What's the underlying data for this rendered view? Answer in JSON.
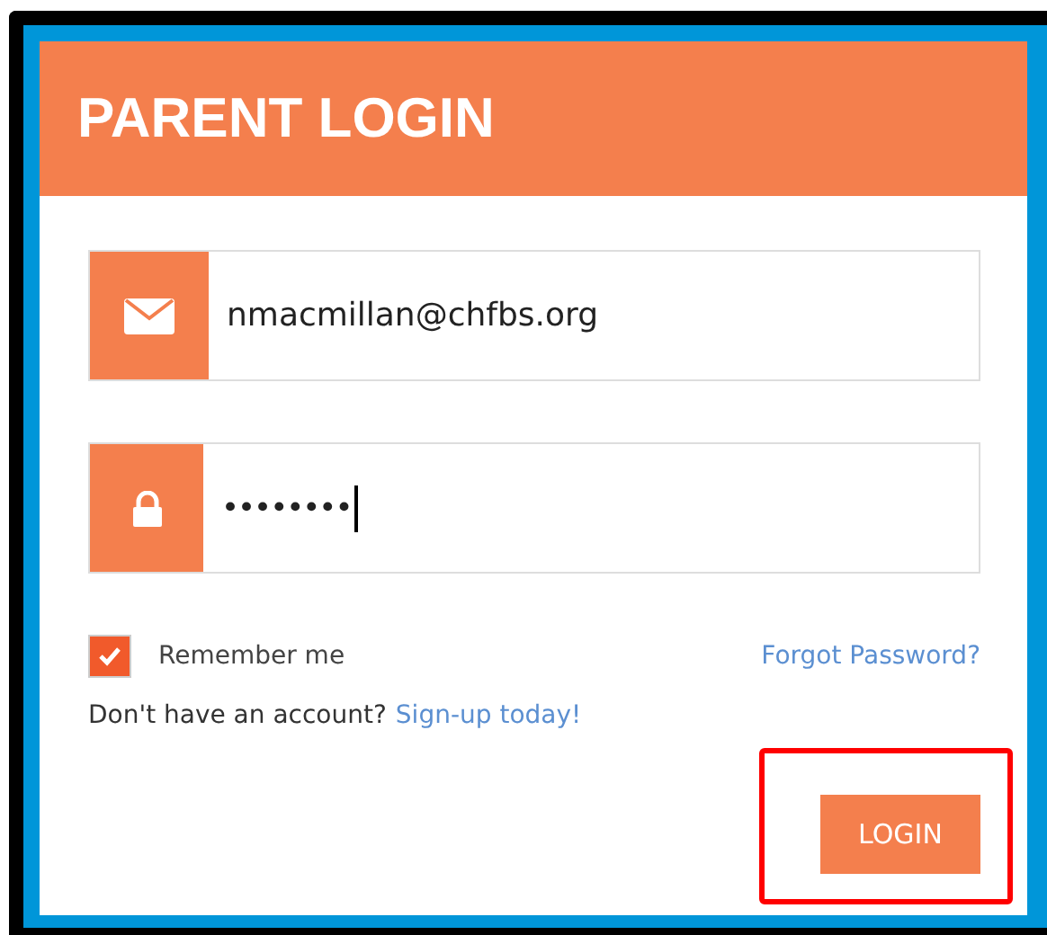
{
  "header": {
    "title": "PARENT LOGIN"
  },
  "email_field": {
    "value": "nmacmillan@chfbs.org"
  },
  "password_field": {
    "value": "••••••••"
  },
  "remember": {
    "label": "Remember me",
    "checked": true
  },
  "forgot_link": "Forgot Password?",
  "signup": {
    "text": "Don't have an account?",
    "link": "Sign-up today!"
  },
  "login_button": {
    "label": "LOGIN",
    "highlighted": true
  }
}
